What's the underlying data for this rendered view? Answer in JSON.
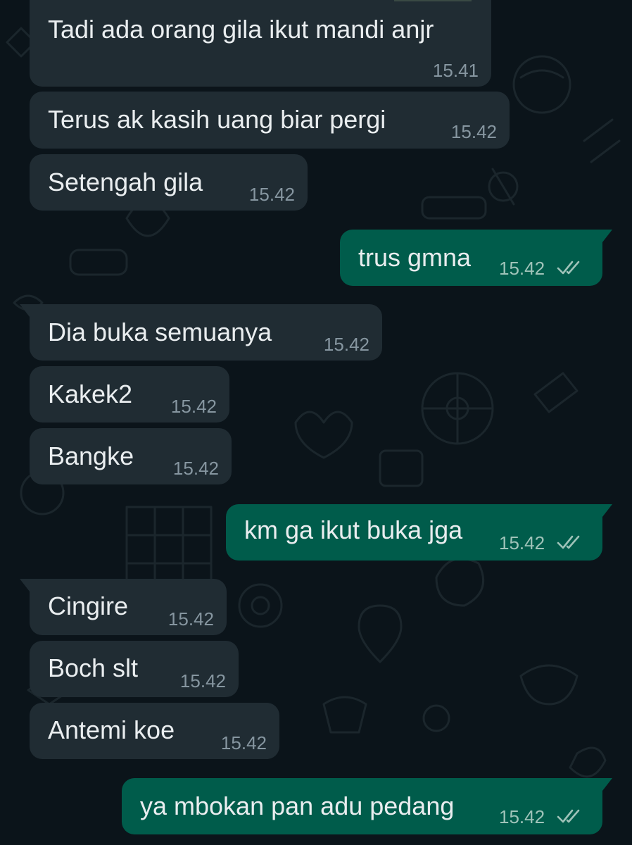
{
  "colors": {
    "background": "#0b141a",
    "incoming_bubble": "#202c33",
    "outgoing_bubble": "#005c4b",
    "text": "#e9edef",
    "timestamp": "#8696a0",
    "read_ticks": "#9fc3b9"
  },
  "messages": [
    {
      "direction": "incoming",
      "text": "Tadi ada orang gila ikut mandi anjr",
      "time": "15.41"
    },
    {
      "direction": "incoming",
      "text": "Terus ak kasih uang biar pergi",
      "time": "15.42"
    },
    {
      "direction": "incoming",
      "text": "Setengah gila",
      "time": "15.42"
    },
    {
      "direction": "outgoing",
      "text": "trus gmna",
      "time": "15.42",
      "status_icon": "double-check-icon"
    },
    {
      "direction": "incoming",
      "text": "Dia buka semuanya",
      "time": "15.42"
    },
    {
      "direction": "incoming",
      "text": "Kakek2",
      "time": "15.42"
    },
    {
      "direction": "incoming",
      "text": "Bangke",
      "time": "15.42"
    },
    {
      "direction": "outgoing",
      "text": "km ga ikut buka jga",
      "time": "15.42",
      "status_icon": "double-check-icon"
    },
    {
      "direction": "incoming",
      "text": "Cingire",
      "time": "15.42"
    },
    {
      "direction": "incoming",
      "text": "Boch slt",
      "time": "15.42"
    },
    {
      "direction": "incoming",
      "text": "Antemi koe",
      "time": "15.42"
    },
    {
      "direction": "outgoing",
      "text": "ya mbokan pan adu pedang",
      "time": "15.42",
      "status_icon": "double-check-icon"
    }
  ]
}
